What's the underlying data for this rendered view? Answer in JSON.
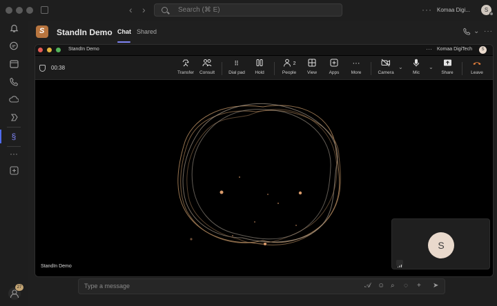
{
  "window": {
    "search_placeholder": "Search (⌘ E)",
    "org_name": "Komaa Digi...",
    "user_initial": "S"
  },
  "rail": {
    "notification_count": "27"
  },
  "chat": {
    "title": "StandIn Demo",
    "tabs": [
      "Chat",
      "Shared"
    ],
    "compose_placeholder": "Type a message"
  },
  "call": {
    "window_title": "StandIn Demo",
    "org_name": "Komaa DigiTech",
    "user_initial": "S",
    "duration": "00:38",
    "stage_label": "StandIn Demo",
    "self_initial": "S",
    "people_count": "2",
    "toolbar": [
      {
        "label": "Transfer",
        "icon": "transfer-icon"
      },
      {
        "label": "Consult",
        "icon": "consult-icon"
      },
      {
        "label": "Dial pad",
        "icon": "dialpad-icon"
      },
      {
        "label": "Hold",
        "icon": "hold-icon"
      },
      {
        "label": "People",
        "icon": "people-icon"
      },
      {
        "label": "View",
        "icon": "view-icon"
      },
      {
        "label": "Apps",
        "icon": "apps-icon"
      },
      {
        "label": "More",
        "icon": "more-icon"
      },
      {
        "label": "Camera",
        "icon": "camera-off-icon"
      },
      {
        "label": "Mic",
        "icon": "mic-icon"
      },
      {
        "label": "Share",
        "icon": "share-icon"
      },
      {
        "label": "Leave",
        "icon": "leave-icon"
      }
    ]
  },
  "colors": {
    "accent": "#7f85f5",
    "leave": "#e07e3c",
    "brand": "#b8753f",
    "visual_ring": "#c89a6a"
  }
}
